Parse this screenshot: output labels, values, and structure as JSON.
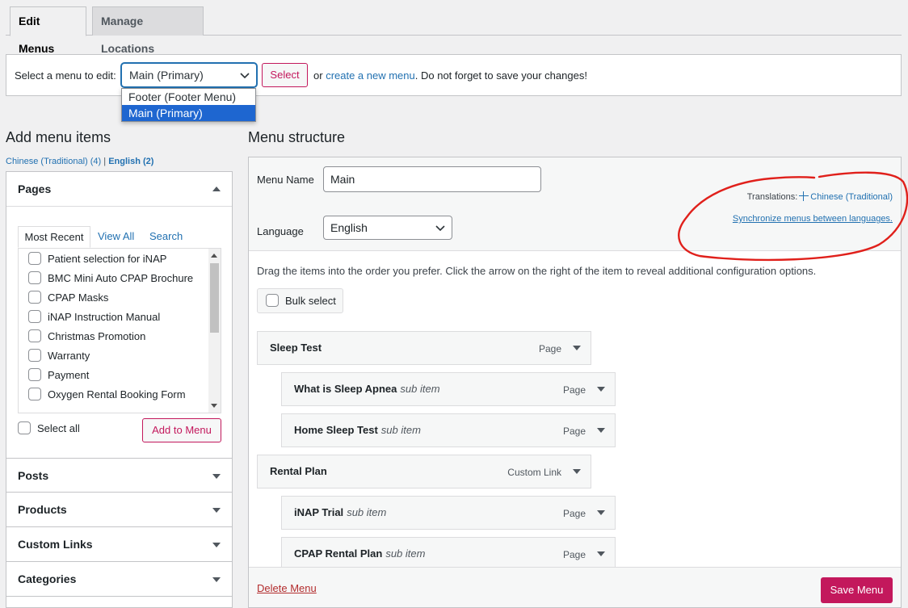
{
  "tabs": [
    {
      "label": "Edit Menus",
      "active": true
    },
    {
      "label": "Manage Locations",
      "active": false
    }
  ],
  "select_bar": {
    "label": "Select a menu to edit:",
    "current": "Main (Primary)",
    "select_button": "Select",
    "or_text": "or",
    "create_link": "create a new menu",
    "tail_text": ". Do not forget to save your changes!"
  },
  "dropdown": {
    "options": [
      "Footer (Footer Menu)",
      "Main (Primary)"
    ],
    "selected_index": 1
  },
  "add_items": {
    "heading": "Add menu items",
    "lang_links": {
      "chinese": "Chinese (Traditional) (4)",
      "sep": "|",
      "english": "English (2)"
    },
    "pages": {
      "title": "Pages",
      "tabs": [
        "Most Recent",
        "View All",
        "Search"
      ],
      "items": [
        "Patient selection for iNAP",
        "BMC Mini Auto CPAP Brochure",
        "CPAP Masks",
        "iNAP Instruction Manual",
        "Christmas Promotion",
        "Warranty",
        "Payment",
        "Oxygen Rental Booking Form"
      ],
      "select_all": "Select all",
      "add_button": "Add to Menu"
    },
    "sections": [
      "Posts",
      "Products",
      "Custom Links",
      "Categories"
    ]
  },
  "structure": {
    "heading": "Menu structure",
    "menu_name_label": "Menu Name",
    "menu_name_value": "Main",
    "language_label": "Language",
    "language_value": "English",
    "translations_label": "Translations:",
    "translations_lang": "Chinese (Traditional)",
    "sync_link": "Synchronize menus between languages.",
    "instructions": "Drag the items into the order you prefer. Click the arrow on the right of the item to reveal additional configuration options.",
    "bulk_select": "Bulk select",
    "items": [
      {
        "title": "Sleep Test",
        "sub": "",
        "type": "Page",
        "depth": 0
      },
      {
        "title": "What is Sleep Apnea",
        "sub": "sub item",
        "type": "Page",
        "depth": 1
      },
      {
        "title": "Home Sleep Test",
        "sub": "sub item",
        "type": "Page",
        "depth": 1
      },
      {
        "title": "Rental Plan",
        "sub": "",
        "type": "Custom Link",
        "depth": 0
      },
      {
        "title": "iNAP Trial",
        "sub": "sub item",
        "type": "Page",
        "depth": 1
      },
      {
        "title": "CPAP Rental Plan",
        "sub": "sub item",
        "type": "Page",
        "depth": 1
      }
    ],
    "delete_link": "Delete Menu",
    "save_button": "Save Menu"
  },
  "colors": {
    "accent": "#c3185c",
    "link": "#2271b1",
    "annotation": "#e0201b"
  }
}
